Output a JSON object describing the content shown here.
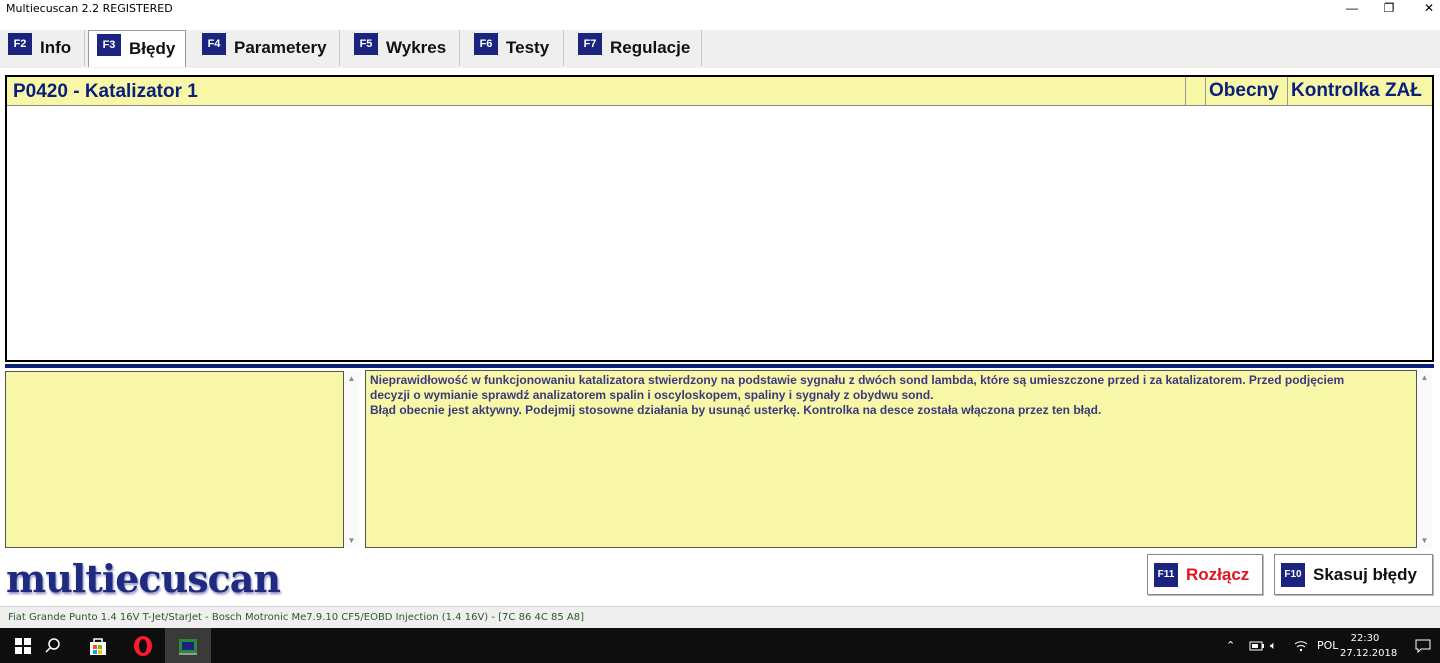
{
  "window": {
    "title": "Multiecuscan 2.2 REGISTERED",
    "minimize_glyph": "—",
    "restore_glyph": "❐",
    "close_glyph": "✕"
  },
  "tabs": [
    {
      "key": "F2",
      "label": "Info",
      "active": false
    },
    {
      "key": "F3",
      "label": "Błędy",
      "active": true
    },
    {
      "key": "F4",
      "label": "Parametery",
      "active": false
    },
    {
      "key": "F5",
      "label": "Wykres",
      "active": false
    },
    {
      "key": "F6",
      "label": "Testy",
      "active": false
    },
    {
      "key": "F7",
      "label": "Regulacje",
      "active": false
    }
  ],
  "faults": [
    {
      "code": "P0420 - Katalizator 1",
      "extra": "",
      "status": "Obecny",
      "mil": "Kontrolka ZAŁ"
    }
  ],
  "description": {
    "line1": "Nieprawidłowość w funkcjonowaniu katalizatora stwierdzony na podstawie sygnału z dwóch sond lambda, które są umieszczone przed i za katalizatorem. Przed podjęciem",
    "line2": "decyzji o wymianie sprawdź analizatorem spalin i oscyloskopem, spaliny i sygnały z obydwu sond.",
    "line3": "Błąd obecnie jest aktywny. Podejmij stosowne działania by usunąć usterkę. Kontrolka na desce została włączona przez ten błąd."
  },
  "logo": "multiecuscan",
  "actions": {
    "disconnect": {
      "key": "F11",
      "label": "Rozłącz"
    },
    "clear": {
      "key": "F10",
      "label": "Skasuj błędy"
    }
  },
  "status": "Fiat Grande Punto 1.4 16V T-Jet/StarJet - Bosch Motronic Me7.9.10 CF5/EOBD Injection (1.4 16V) - [7C 86 4C 85 A8]",
  "taskbar": {
    "language": "POL",
    "time": "22:30",
    "date": "27.12.2018"
  },
  "colors": {
    "accent_navy": "#1a237e",
    "panel_yellow": "#f8f7a8",
    "fault_text": "#0a1f7a",
    "disconnect_red": "#e0141e"
  }
}
